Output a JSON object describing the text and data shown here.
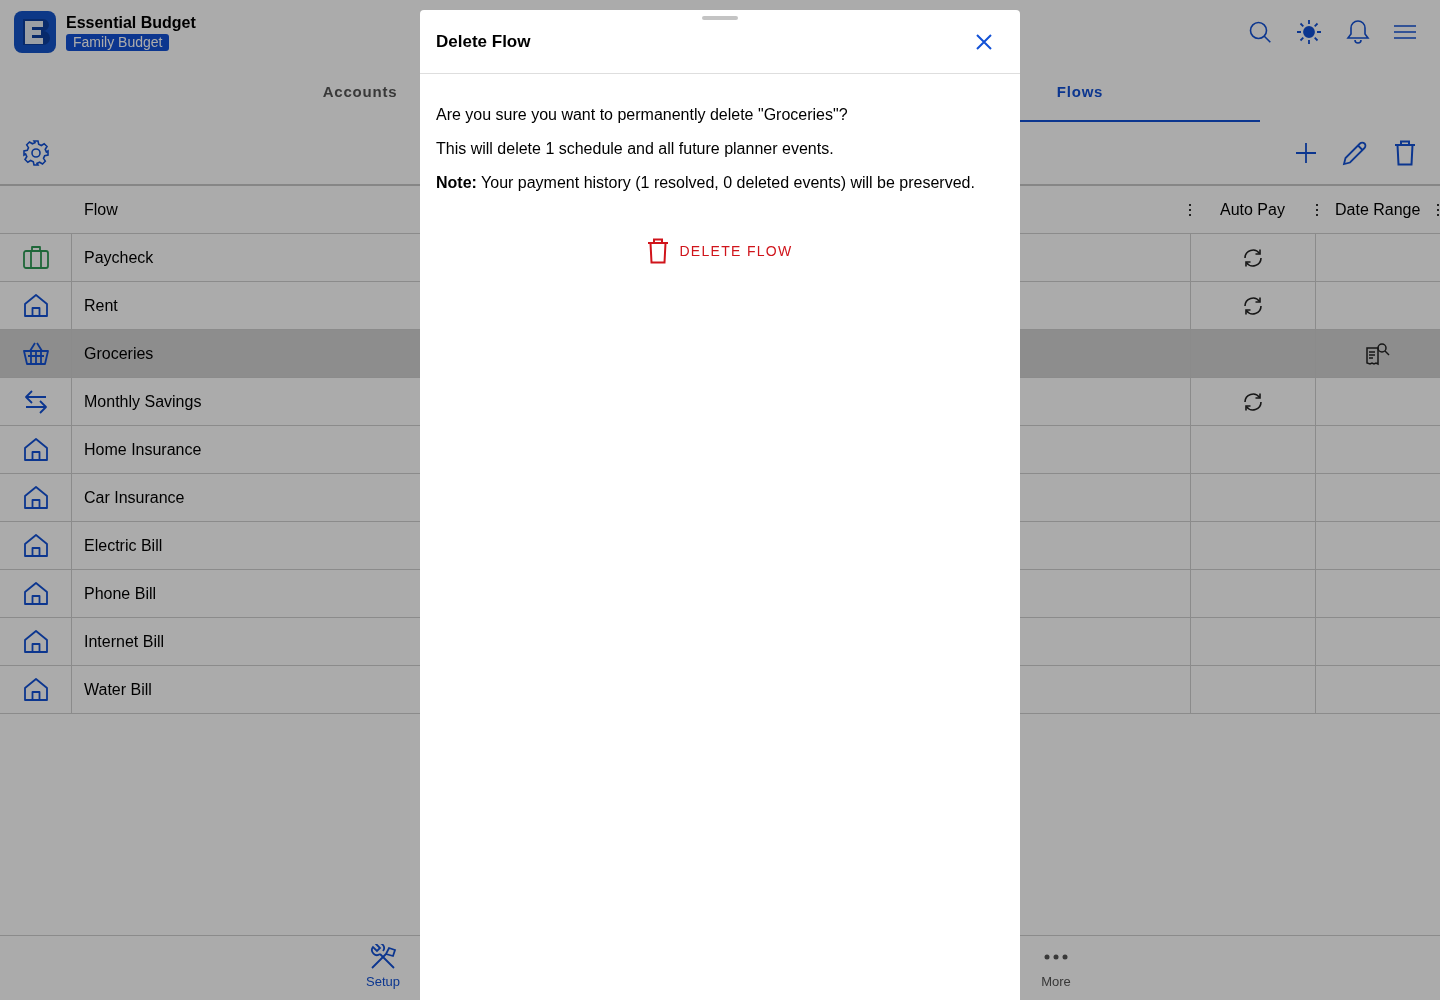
{
  "app": {
    "title": "Essential Budget",
    "badge": "Family Budget"
  },
  "tabs": [
    {
      "label": "Accounts",
      "selected": false
    },
    {
      "label": "Flows",
      "selected": true
    }
  ],
  "table": {
    "columns": [
      "Flow",
      "Auto Pay",
      "Date Range"
    ],
    "rows": [
      {
        "kind": "briefcase",
        "name": "Paycheck",
        "auto_pay": true,
        "date_range_details": false,
        "selected": false
      },
      {
        "kind": "house",
        "name": "Rent",
        "auto_pay": true,
        "date_range_details": false,
        "selected": false
      },
      {
        "kind": "basket",
        "name": "Groceries",
        "auto_pay": false,
        "date_range_details": true,
        "selected": true
      },
      {
        "kind": "transfer",
        "name": "Monthly Savings",
        "auto_pay": true,
        "date_range_details": false,
        "selected": false
      },
      {
        "kind": "house",
        "name": "Home Insurance",
        "auto_pay": false,
        "date_range_details": false,
        "selected": false
      },
      {
        "kind": "house",
        "name": "Car Insurance",
        "auto_pay": false,
        "date_range_details": false,
        "selected": false
      },
      {
        "kind": "house",
        "name": "Electric Bill",
        "auto_pay": false,
        "date_range_details": false,
        "selected": false
      },
      {
        "kind": "house",
        "name": "Phone Bill",
        "auto_pay": false,
        "date_range_details": false,
        "selected": false
      },
      {
        "kind": "house",
        "name": "Internet Bill",
        "auto_pay": false,
        "date_range_details": false,
        "selected": false
      },
      {
        "kind": "house",
        "name": "Water Bill",
        "auto_pay": false,
        "date_range_details": false,
        "selected": false
      }
    ]
  },
  "bottom_nav": [
    {
      "kind": "tools",
      "label": "Setup",
      "selected": true
    },
    {
      "kind": "dots",
      "label": "More",
      "selected": false
    }
  ],
  "dialog": {
    "title": "Delete Flow",
    "paragraphs": [
      "Are you sure you want to permanently delete \"Groceries\"?",
      "This will delete 1 schedule and all future planner events.",
      "**Note:** Your payment history (1 resolved, 0 deleted events) will be preserved."
    ],
    "action": "DELETE FLOW"
  }
}
